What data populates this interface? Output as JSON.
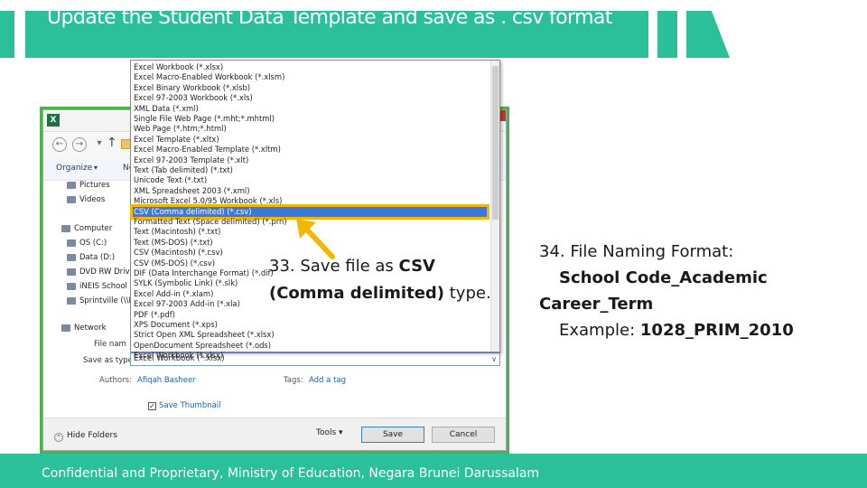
{
  "header": {
    "title": "Update the Student Data Template and save as . csv format"
  },
  "footer": {
    "text": "Confidential and Proprietary, Ministry of Education, Negara Brunei Darussalam"
  },
  "dialog": {
    "app_icon": "X",
    "organize_label": "Organize",
    "new_label": "Ne",
    "nav_items": [
      "Pictures",
      "Videos",
      "Computer",
      "OS (C:)",
      "Data (D:)",
      "DVD RW Drive",
      "iNEIS School D",
      "Sprintville (\\\\H",
      "Network"
    ],
    "file_name_label": "File nam",
    "save_type_label": "Save as type:",
    "save_type_value": "Excel Workbook (*.xlsx)",
    "authors_label": "Authors:",
    "authors_value": "Afiqah Basheer",
    "tags_label": "Tags:",
    "tags_value": "Add a tag",
    "save_thumbnail_label": "Save Thumbnail",
    "hide_folders_label": "Hide Folders",
    "tools_label": "Tools",
    "save_button": "Save",
    "cancel_button": "Cancel"
  },
  "file_types": [
    "Excel Workbook (*.xlsx)",
    "Excel Macro-Enabled Workbook (*.xlsm)",
    "Excel Binary Workbook (*.xlsb)",
    "Excel 97-2003 Workbook (*.xls)",
    "XML Data (*.xml)",
    "Single File Web Page (*.mht;*.mhtml)",
    "Web Page (*.htm;*.html)",
    "Excel Template (*.xltx)",
    "Excel Macro-Enabled Template (*.xltm)",
    "Excel 97-2003 Template (*.xlt)",
    "Text (Tab delimited) (*.txt)",
    "Unicode Text (*.txt)",
    "XML Spreadsheet 2003 (*.xml)",
    "Microsoft Excel 5.0/95 Workbook (*.xls)",
    "CSV (Comma delimited) (*.csv)",
    "Formatted Text (Space delimited) (*.prn)",
    "Text (Macintosh) (*.txt)",
    "Text (MS-DOS) (*.txt)",
    "CSV (Macintosh) (*.csv)",
    "CSV (MS-DOS) (*.csv)",
    "DIF (Data Interchange Format) (*.dif)",
    "SYLK (Symbolic Link) (*.slk)",
    "Excel Add-in (*.xlam)",
    "Excel 97-2003 Add-in (*.xla)",
    "PDF (*.pdf)",
    "XPS Document (*.xps)",
    "Strict Open XML Spreadsheet (*.xlsx)",
    "OpenDocument Spreadsheet (*.ods)",
    "Excel Workbook (*.xlsx)"
  ],
  "selected_file_type_index": 14,
  "callout_33": {
    "prefix": "33. Save file as ",
    "bold1": "CSV",
    "bold2": "(Comma delimited)",
    "suffix": " type."
  },
  "callout_34": {
    "line1": "34. File Naming Format:",
    "line2_pre": "    ",
    "line2": "School Code_Academic",
    "line3": "Career_Term",
    "line4_pre": "    Example: ",
    "line4_bold": "1028_PRIM_2010"
  },
  "colors": {
    "accent": "#2bbf9a",
    "highlight": "#f2b705",
    "selection": "#3c78d8"
  }
}
